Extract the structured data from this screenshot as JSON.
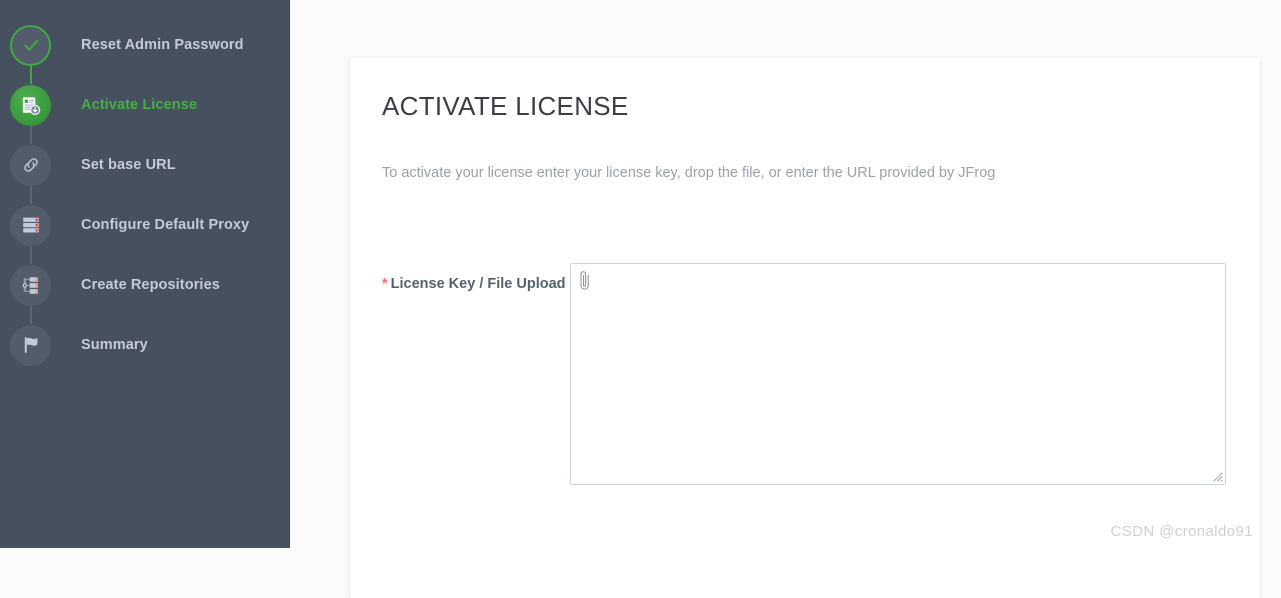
{
  "colors": {
    "sidebar_bg": "#46505f",
    "accent_green": "#43b043",
    "badge_bg": "#525c6b",
    "step_text": "#c5cad9",
    "page_bg": "#fbfbfb",
    "card_bg": "#ffffff",
    "title_text": "#3a3f47",
    "desc_text": "#9ba0ab",
    "label_text": "#55606e",
    "required_star": "#ef6d6d",
    "input_border": "#ccd4e0",
    "watermark_text": "#cfcfcf"
  },
  "sidebar": {
    "steps": [
      {
        "label": "Reset Admin Password",
        "icon": "check-icon",
        "state": "done"
      },
      {
        "label": "Activate License",
        "icon": "license-doc-icon",
        "state": "active"
      },
      {
        "label": "Set base URL",
        "icon": "link-icon",
        "state": "pending"
      },
      {
        "label": "Configure Default Proxy",
        "icon": "server-stack-icon",
        "state": "pending"
      },
      {
        "label": "Create Repositories",
        "icon": "hierarchy-icon",
        "state": "pending"
      },
      {
        "label": "Summary",
        "icon": "flag-icon",
        "state": "pending"
      }
    ]
  },
  "main": {
    "title": "ACTIVATE LICENSE",
    "description": "To activate your license enter your license key, drop the file, or enter the URL provided by JFrog",
    "form": {
      "license_field": {
        "required_marker": "*",
        "label": "License Key / File Upload",
        "value": "",
        "placeholder": "",
        "attach_icon": "paperclip-icon"
      }
    }
  },
  "watermark": {
    "text": "CSDN @cronaldo91"
  }
}
